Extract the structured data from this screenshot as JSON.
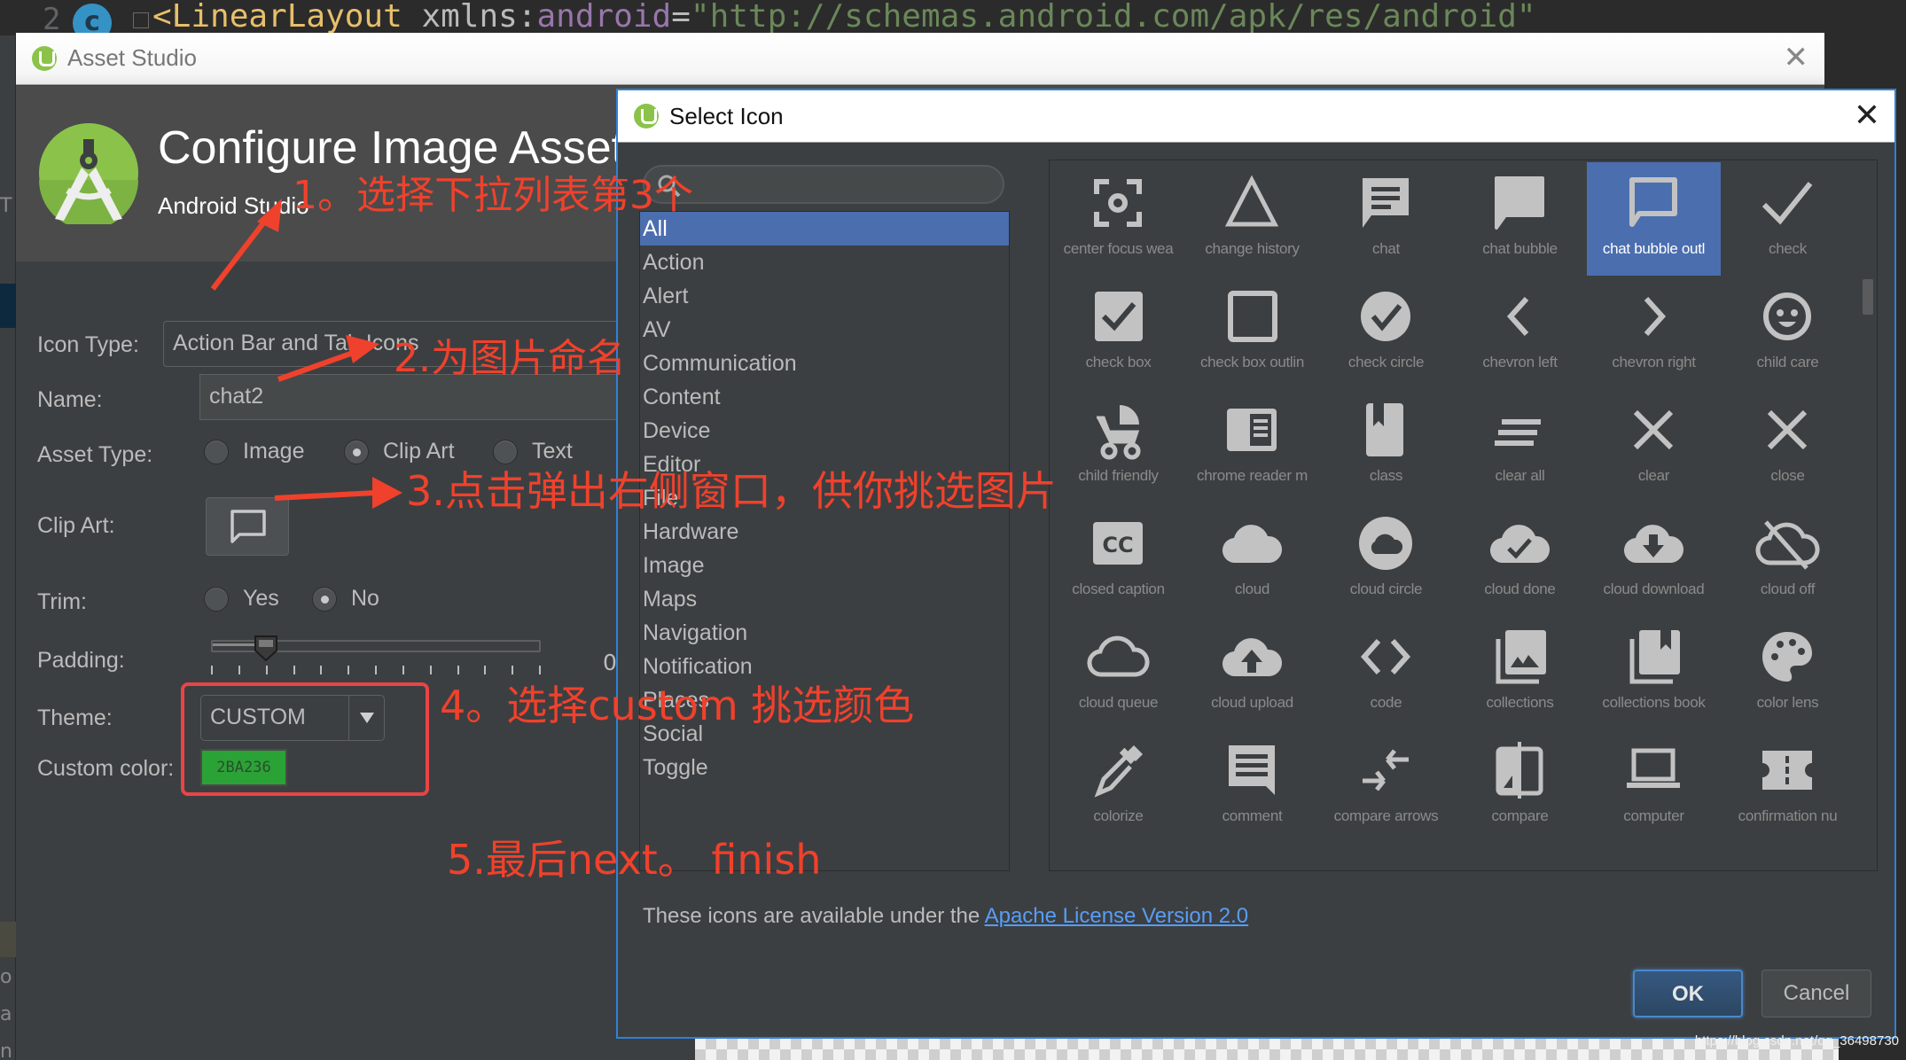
{
  "ide": {
    "line_number": "2",
    "class_badge": "c",
    "code_tag": "<LinearLayout",
    "code_attr": " xmlns:",
    "code_ns": "android",
    "code_eq": "=",
    "code_string": "\"http://schemas.android.com/apk/res/android\"",
    "left_strip_letters": [
      "T",
      "o",
      "a",
      "n"
    ],
    "watermark": "https://blog.csdn.net/qq_36498730"
  },
  "asset_studio": {
    "window_title": "Asset Studio",
    "header_title": "Configure Image Asset",
    "header_subtitle": "Android Studio",
    "form": {
      "icon_type_label": "Icon Type:",
      "icon_type_value": "Action Bar and Tab Icons",
      "name_label": "Name:",
      "name_value": "chat2",
      "asset_type_label": "Asset Type:",
      "asset_type_options": [
        {
          "label": "Image",
          "selected": false
        },
        {
          "label": "Clip Art",
          "selected": true
        },
        {
          "label": "Text",
          "selected": false
        }
      ],
      "clip_art_label": "Clip Art:",
      "clip_art_icon": "chat-bubble-outline-icon",
      "trim_label": "Trim:",
      "trim_options": [
        {
          "label": "Yes",
          "selected": false
        },
        {
          "label": "No",
          "selected": true
        }
      ],
      "padding_label": "Padding:",
      "padding_fraction": 0.167,
      "padding_tick_count": 13,
      "padding_value_text": "0",
      "theme_label": "Theme:",
      "theme_value": "CUSTOM",
      "custom_color_label": "Custom color:",
      "custom_color_value": "2BA236",
      "custom_color_hex": "#2ba236"
    }
  },
  "annotations": [
    {
      "id": "step1",
      "text": "1。选择下拉列表第3个"
    },
    {
      "id": "step2",
      "text": "2.为图片命名"
    },
    {
      "id": "step3",
      "text": "3.点击弹出右侧窗口，供你挑选图片"
    },
    {
      "id": "step4",
      "text": "4。选择custom 挑选颜色"
    },
    {
      "id": "step5",
      "text": "5.最后next。 finish"
    }
  ],
  "select_icon": {
    "title": "Select Icon",
    "search_placeholder": "",
    "categories": [
      {
        "label": "All",
        "selected": true
      },
      {
        "label": "Action",
        "selected": false
      },
      {
        "label": "Alert",
        "selected": false
      },
      {
        "label": "AV",
        "selected": false
      },
      {
        "label": "Communication",
        "selected": false
      },
      {
        "label": "Content",
        "selected": false
      },
      {
        "label": "Device",
        "selected": false
      },
      {
        "label": "Editor",
        "selected": false
      },
      {
        "label": "File",
        "selected": false
      },
      {
        "label": "Hardware",
        "selected": false
      },
      {
        "label": "Image",
        "selected": false
      },
      {
        "label": "Maps",
        "selected": false
      },
      {
        "label": "Navigation",
        "selected": false
      },
      {
        "label": "Notification",
        "selected": false
      },
      {
        "label": "Places",
        "selected": false
      },
      {
        "label": "Social",
        "selected": false
      },
      {
        "label": "Toggle",
        "selected": false
      }
    ],
    "icons": [
      {
        "label": "center focus wea",
        "icon": "center-focus-weak-icon"
      },
      {
        "label": "change history",
        "icon": "change-history-icon"
      },
      {
        "label": "chat",
        "icon": "chat-icon"
      },
      {
        "label": "chat bubble",
        "icon": "chat-bubble-icon"
      },
      {
        "label": "chat bubble outl",
        "icon": "chat-bubble-outline-icon",
        "selected": true
      },
      {
        "label": "check",
        "icon": "check-icon"
      },
      {
        "label": "check box",
        "icon": "check-box-icon"
      },
      {
        "label": "check box outlin",
        "icon": "check-box-outline-icon"
      },
      {
        "label": "check circle",
        "icon": "check-circle-icon"
      },
      {
        "label": "chevron left",
        "icon": "chevron-left-icon"
      },
      {
        "label": "chevron right",
        "icon": "chevron-right-icon"
      },
      {
        "label": "child care",
        "icon": "child-care-icon"
      },
      {
        "label": "child friendly",
        "icon": "child-friendly-icon"
      },
      {
        "label": "chrome reader m",
        "icon": "chrome-reader-mode-icon"
      },
      {
        "label": "class",
        "icon": "class-icon"
      },
      {
        "label": "clear all",
        "icon": "clear-all-icon"
      },
      {
        "label": "clear",
        "icon": "clear-icon"
      },
      {
        "label": "close",
        "icon": "close-icon"
      },
      {
        "label": "closed caption",
        "icon": "closed-caption-icon"
      },
      {
        "label": "cloud",
        "icon": "cloud-icon"
      },
      {
        "label": "cloud circle",
        "icon": "cloud-circle-icon"
      },
      {
        "label": "cloud done",
        "icon": "cloud-done-icon"
      },
      {
        "label": "cloud download",
        "icon": "cloud-download-icon"
      },
      {
        "label": "cloud off",
        "icon": "cloud-off-icon"
      },
      {
        "label": "cloud queue",
        "icon": "cloud-queue-icon"
      },
      {
        "label": "cloud upload",
        "icon": "cloud-upload-icon"
      },
      {
        "label": "code",
        "icon": "code-icon"
      },
      {
        "label": "collections",
        "icon": "collections-icon"
      },
      {
        "label": "collections book",
        "icon": "collections-bookmark-icon"
      },
      {
        "label": "color lens",
        "icon": "color-lens-icon"
      },
      {
        "label": "colorize",
        "icon": "colorize-icon"
      },
      {
        "label": "comment",
        "icon": "comment-icon"
      },
      {
        "label": "compare arrows",
        "icon": "compare-arrows-icon"
      },
      {
        "label": "compare",
        "icon": "compare-icon"
      },
      {
        "label": "computer",
        "icon": "computer-icon"
      },
      {
        "label": "confirmation nu",
        "icon": "confirmation-number-icon"
      },
      {
        "label": "",
        "icon": "contact-mail-icon"
      },
      {
        "label": "",
        "icon": "contact-phone-icon"
      },
      {
        "label": "",
        "icon": "contacts-icon"
      },
      {
        "label": "",
        "icon": "content-copy-icon"
      },
      {
        "label": "",
        "icon": "content-cut-icon"
      },
      {
        "label": "",
        "icon": "content-paste-icon"
      }
    ],
    "license_text": "These icons are available under the ",
    "license_link": "Apache License Version 2.0",
    "ok_label": "OK",
    "cancel_label": "Cancel"
  }
}
